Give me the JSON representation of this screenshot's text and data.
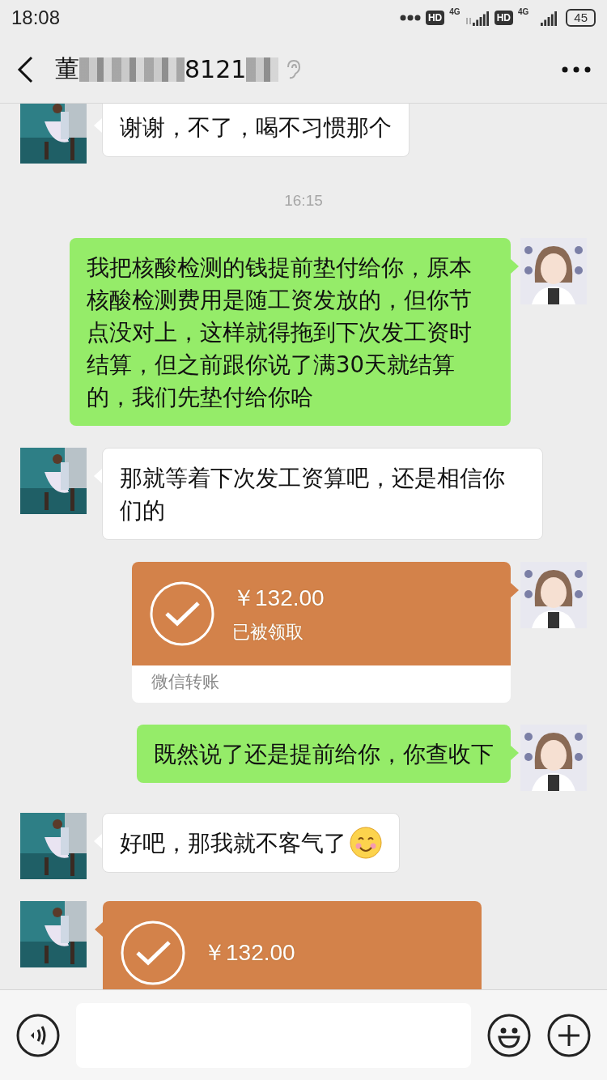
{
  "status_bar": {
    "time": "18:08",
    "network": [
      {
        "badge": "HD",
        "type": "4G",
        "arrows": true
      },
      {
        "badge": "HD",
        "type": "4G",
        "arrows": false
      }
    ],
    "battery": "45"
  },
  "header": {
    "title_start": "董",
    "title_middle": "8121"
  },
  "messages": [
    {
      "kind": "text",
      "outgoing": false,
      "text": "谢谢，不了，喝不习惯那个"
    },
    {
      "kind": "time",
      "text": "16:15"
    },
    {
      "kind": "text",
      "outgoing": true,
      "text": "我把核酸检测的钱提前垫付给你，原本核酸检测费用是随工资发放的，但你节点没对上，这样就得拖到下次发工资时结算，但之前跟你说了满30天就结算的，我们先垫付给你哈"
    },
    {
      "kind": "text",
      "outgoing": false,
      "text": "那就等着下次发工资算吧，还是相信你们的"
    },
    {
      "kind": "transfer",
      "outgoing": true,
      "amount": "￥132.00",
      "status": "已被领取",
      "footer": "微信转账",
      "received": true
    },
    {
      "kind": "text",
      "outgoing": true,
      "text": "既然说了还是提前给你，你查收下"
    },
    {
      "kind": "text",
      "outgoing": false,
      "text": "好吧，那我就不客气了",
      "emoji": true
    },
    {
      "kind": "transfer",
      "outgoing": false,
      "amount": "￥132.00",
      "received": true
    }
  ]
}
